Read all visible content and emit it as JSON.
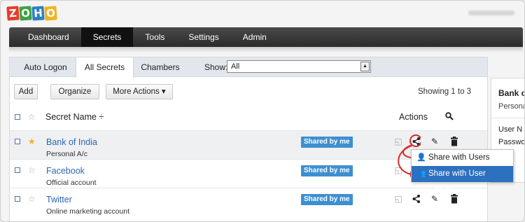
{
  "brand": {
    "logo_letters": [
      "Z",
      "O",
      "H",
      "O"
    ],
    "logo_colors": [
      "#e63c2a",
      "#3ea244",
      "#2c7fc1",
      "#f3b21f"
    ]
  },
  "nav": {
    "items": [
      "Dashboard",
      "Secrets",
      "Tools",
      "Settings",
      "Admin"
    ],
    "active": "Secrets"
  },
  "tabs": {
    "items": [
      "Auto Logon",
      "All Secrets",
      "Chambers"
    ],
    "active": "All Secrets",
    "show_label": "Show:",
    "show_value": "All"
  },
  "toolbar": {
    "add_label": "Add",
    "organize_label": "Organize",
    "more_actions_label": "More Actions ▾",
    "showing_text": "Showing 1 to 3"
  },
  "table": {
    "col_name": "Secret Name ÷",
    "col_actions": "Actions",
    "rows": [
      {
        "name": "Bank of India",
        "desc": "Personal A/c",
        "badge": "Shared by me",
        "favorite": true
      },
      {
        "name": "Facebook",
        "desc": "Official account",
        "badge": "Shared by me",
        "favorite": false
      },
      {
        "name": "Twitter",
        "desc": "Online marketing account",
        "badge": "Shared by me",
        "favorite": false
      }
    ]
  },
  "side_panel": {
    "title": "Bank o",
    "subtitle": "Persona",
    "field1": "User N",
    "field2": "Passwo"
  },
  "share_menu": {
    "items": [
      "Share with Users",
      "Share with User Groups"
    ],
    "selected": "Share with User Groups"
  },
  "colors": {
    "accent": "#2d70bd",
    "badge": "#3e8fd1",
    "link": "#2a67b0",
    "annotation": "#d62b2b"
  }
}
